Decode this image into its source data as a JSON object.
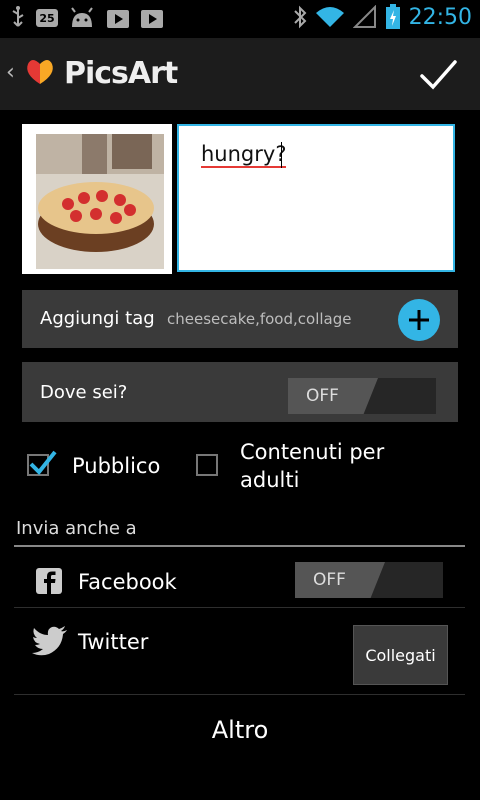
{
  "status_bar": {
    "notification_count": "25",
    "time": "22:50"
  },
  "action_bar": {
    "app_name": "PicsArt"
  },
  "post": {
    "caption": "hungry?"
  },
  "tags": {
    "label": "Aggiungi tag",
    "value": "cheesecake,food,collage"
  },
  "location": {
    "label": "Dove sei?",
    "toggle_state": "OFF"
  },
  "options": {
    "public_label": "Pubblico",
    "public_checked": true,
    "adult_label": "Contenuti per adulti",
    "adult_checked": false
  },
  "share": {
    "section_title": "Invia anche a",
    "facebook_label": "Facebook",
    "facebook_toggle": "OFF",
    "twitter_label": "Twitter",
    "twitter_connect": "Collegati"
  },
  "more_label": "Altro",
  "colors": {
    "accent": "#33b5e5",
    "panel": "#3a3a3a",
    "background": "#000000"
  }
}
